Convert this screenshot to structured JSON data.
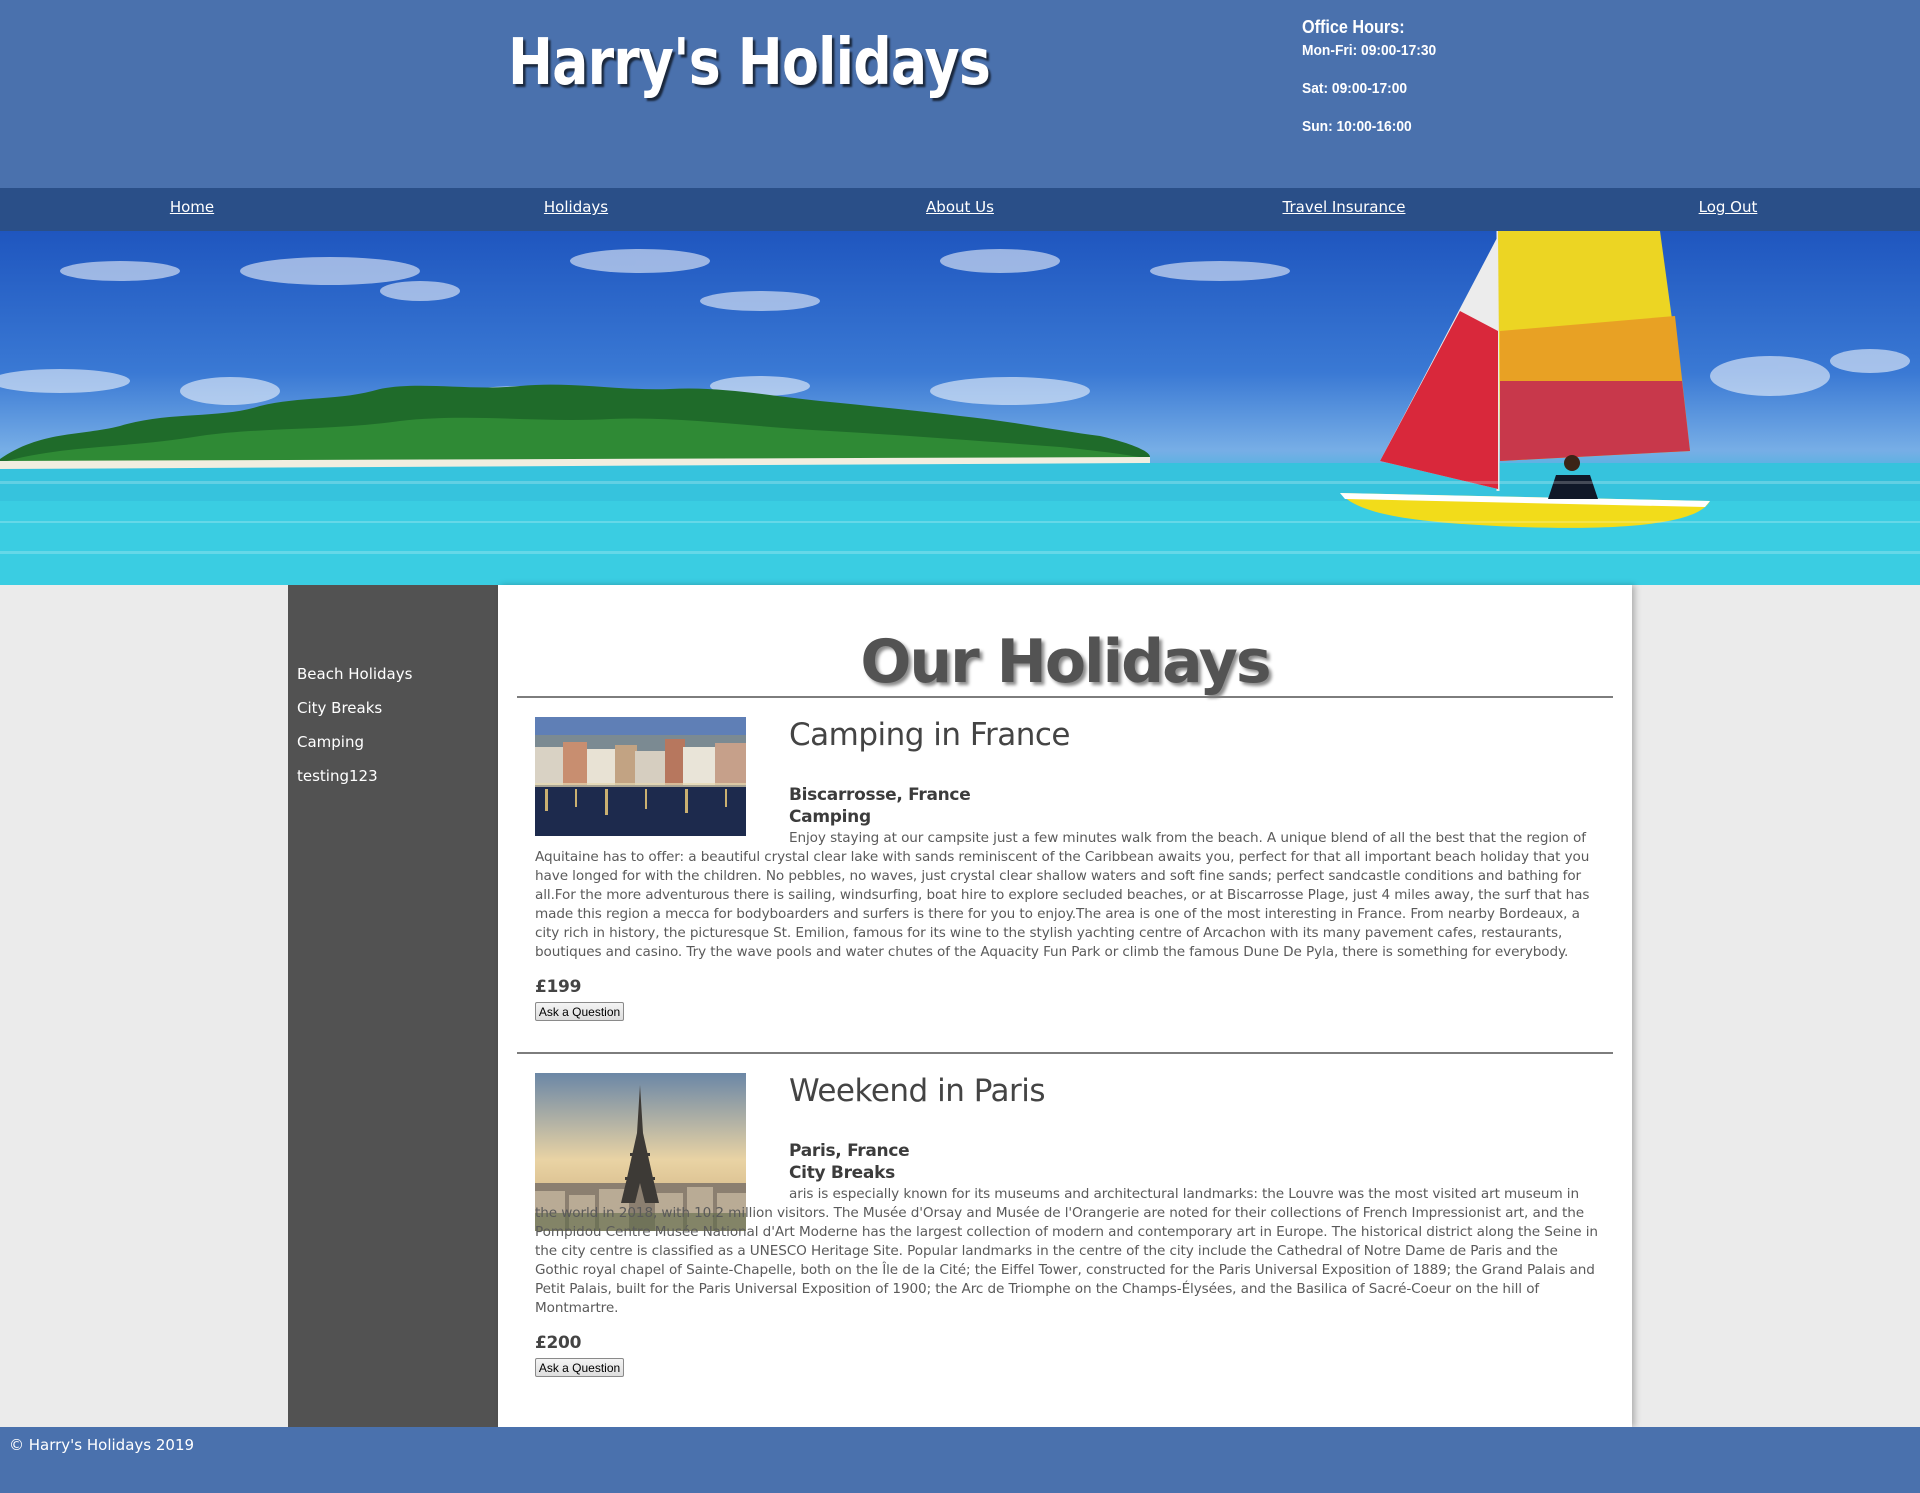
{
  "site": {
    "title": "Harry's Holidays",
    "office_hours": {
      "title": "Office Hours:",
      "lines": [
        "Mon-Fri: 09:00-17:30",
        "Sat: 09:00-17:00",
        "Sun: 10:00-16:00"
      ]
    }
  },
  "nav": {
    "items": [
      {
        "label": "Home"
      },
      {
        "label": "Holidays"
      },
      {
        "label": "About Us"
      },
      {
        "label": "Travel Insurance"
      },
      {
        "label": "Log Out"
      }
    ]
  },
  "sidebar": {
    "items": [
      {
        "label": "Beach Holidays"
      },
      {
        "label": "City Breaks"
      },
      {
        "label": "Camping"
      },
      {
        "label": "testing123"
      }
    ]
  },
  "main": {
    "heading": "Our Holidays",
    "holidays": [
      {
        "title": "Camping in France",
        "location": "Biscarrosse, France",
        "category": "Camping",
        "description": "Enjoy staying at our campsite just a few minutes walk from the beach. A unique blend of all the best that the region of Aquitaine has to offer: a beautiful crystal clear lake with sands reminiscent of the Caribbean awaits you, perfect for that all important beach holiday that you have longed for with the children. No pebbles, no waves, just crystal clear shallow waters and soft fine sands; perfect sandcastle conditions and bathing for all.For the more adventurous there is sailing, windsurfing, boat hire to explore secluded beaches, or at Biscarrosse Plage, just 4 miles away, the surf that has made this region a mecca for bodyboarders and surfers is there for you to enjoy.The area is one of the most interesting in France. From nearby Bordeaux, a city rich in history, the picturesque St. Emilion, famous for its wine to the stylish yachting centre of Arcachon with its many pavement cafes, restaurants, boutiques and casino. Try the wave pools and water chutes of the Aquacity Fun Park or climb the famous Dune De Pyla, there is something for everybody.",
        "price": "£199",
        "button_label": "Ask a Question"
      },
      {
        "title": "Weekend in Paris",
        "location": "Paris, France",
        "category": "City Breaks",
        "description": "aris is especially known for its museums and architectural landmarks: the Louvre was the most visited art museum in the world in 2018, with 10.2 million visitors. The Musée d'Orsay and Musée de l'Orangerie are noted for their collections of French Impressionist art, and the Pompidou Centre Musée National d'Art Moderne has the largest collection of modern and contemporary art in Europe. The historical district along the Seine in the city centre is classified as a UNESCO Heritage Site. Popular landmarks in the centre of the city include the Cathedral of Notre Dame de Paris and the Gothic royal chapel of Sainte-Chapelle, both on the Île de la Cité; the Eiffel Tower, constructed for the Paris Universal Exposition of 1889; the Grand Palais and Petit Palais, built for the Paris Universal Exposition of 1900; the Arc de Triomphe on the Champs-Élysées, and the Basilica of Sacré-Coeur on the hill of Montmartre.",
        "price": "£200",
        "button_label": "Ask a Question"
      }
    ]
  },
  "footer": {
    "text": "© Harry's Holidays 2019"
  },
  "colors": {
    "header_bg": "#4a71ad",
    "nav_bg": "#2a4f88",
    "sidebar_bg": "#525252",
    "page_bg": "#ebebeb"
  }
}
